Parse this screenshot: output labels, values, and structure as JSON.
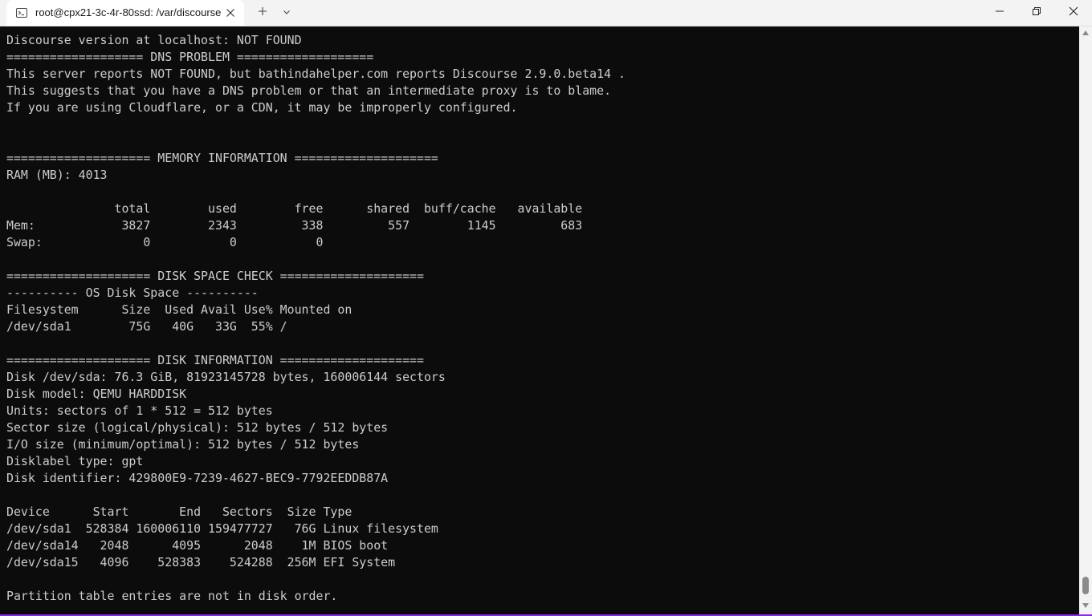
{
  "window": {
    "tab_title": "root@cpx21-3c-4r-80ssd: /var/discourse",
    "icons": {
      "tab": "terminal-icon",
      "close_tab": "close-icon",
      "new_tab": "plus-icon",
      "dropdown": "chevron-down-icon",
      "minimize": "minimize-icon",
      "maximize": "maximize-icon",
      "close_window": "close-icon"
    },
    "accent_color": "#8a2be2"
  },
  "terminal": {
    "foreground": "#cccccc",
    "background": "#0c0c0c",
    "lines": [
      "Discourse version at localhost: NOT FOUND",
      "=================== DNS PROBLEM ===================",
      "This server reports NOT FOUND, but bathindahelper.com reports Discourse 2.9.0.beta14 .",
      "This suggests that you have a DNS problem or that an intermediate proxy is to blame.",
      "If you are using Cloudflare, or a CDN, it may be improperly configured.",
      "",
      "",
      "==================== MEMORY INFORMATION ====================",
      "RAM (MB): 4013",
      "",
      "               total        used        free      shared  buff/cache   available",
      "Mem:            3827        2343         338         557        1145         683",
      "Swap:              0           0           0",
      "",
      "==================== DISK SPACE CHECK ====================",
      "---------- OS Disk Space ----------",
      "Filesystem      Size  Used Avail Use% Mounted on",
      "/dev/sda1        75G   40G   33G  55% /",
      "",
      "==================== DISK INFORMATION ====================",
      "Disk /dev/sda: 76.3 GiB, 81923145728 bytes, 160006144 sectors",
      "Disk model: QEMU HARDDISK",
      "Units: sectors of 1 * 512 = 512 bytes",
      "Sector size (logical/physical): 512 bytes / 512 bytes",
      "I/O size (minimum/optimal): 512 bytes / 512 bytes",
      "Disklabel type: gpt",
      "Disk identifier: 429800E9-7239-4627-BEC9-7792EEDDB87A",
      "",
      "Device      Start       End   Sectors  Size Type",
      "/dev/sda1  528384 160006110 159477727   76G Linux filesystem",
      "/dev/sda14   2048      4095      2048    1M BIOS boot",
      "/dev/sda15   4096    528383    524288  256M EFI System",
      "",
      "Partition table entries are not in disk order."
    ]
  }
}
